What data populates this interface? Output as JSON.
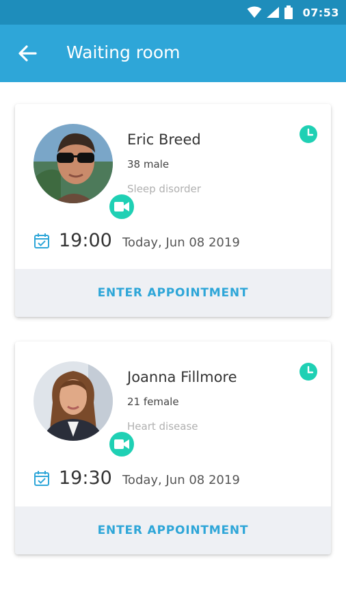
{
  "status_bar": {
    "time": "07:53"
  },
  "app_bar": {
    "title": "Waiting room",
    "back_icon": "arrow-back-icon"
  },
  "colors": {
    "primary": "#2ea6d8",
    "status_bar": "#1e8dbb",
    "accent": "#1fd0b4",
    "button_bg": "#eef0f4"
  },
  "appointments": [
    {
      "name": "Eric Breed",
      "info": "38 male",
      "condition": "Sleep disorder",
      "time": "19:00",
      "date": "Today, Jun 08 2019",
      "button_label": "ENTER APPOINTMENT"
    },
    {
      "name": "Joanna Fillmore",
      "info": "21 female",
      "condition": "Heart disease",
      "time": "19:30",
      "date": "Today, Jun 08 2019",
      "button_label": "ENTER APPOINTMENT"
    }
  ]
}
